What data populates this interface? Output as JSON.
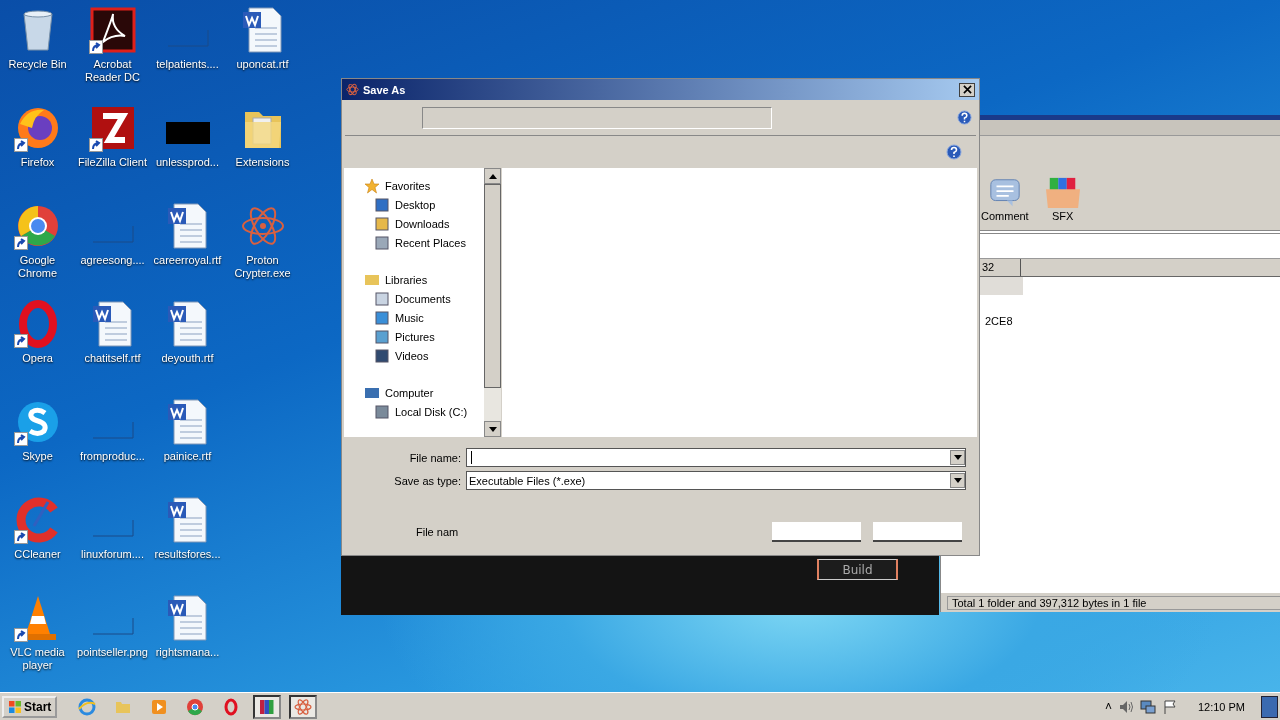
{
  "desktop": {
    "icons": [
      {
        "label": "Recycle Bin",
        "kind": "recycle",
        "shortcut": false
      },
      {
        "label": "Firefox",
        "kind": "firefox",
        "shortcut": true
      },
      {
        "label": "Google Chrome",
        "kind": "chrome",
        "shortcut": true
      },
      {
        "label": "Opera",
        "kind": "opera",
        "shortcut": true
      },
      {
        "label": "Skype",
        "kind": "skype",
        "shortcut": true
      },
      {
        "label": "CCleaner",
        "kind": "ccleaner",
        "shortcut": true
      },
      {
        "label": "VLC media player",
        "kind": "vlc",
        "shortcut": true
      },
      {
        "label": "Acrobat Reader DC",
        "kind": "acrobat",
        "shortcut": true
      },
      {
        "label": "FileZilla Client",
        "kind": "filezilla",
        "shortcut": true
      },
      {
        "label": "agreesong....",
        "kind": "blank",
        "shortcut": false
      },
      {
        "label": "chatitself.rtf",
        "kind": "word",
        "shortcut": false
      },
      {
        "label": "fromproduc...",
        "kind": "blank",
        "shortcut": false
      },
      {
        "label": "linuxforum....",
        "kind": "blank",
        "shortcut": false
      },
      {
        "label": "pointseller.png",
        "kind": "blank",
        "shortcut": false
      },
      {
        "label": "telpatients....",
        "kind": "blank",
        "shortcut": false
      },
      {
        "label": "unlessprod...",
        "kind": "black",
        "shortcut": false
      },
      {
        "label": "careerroyal.rtf",
        "kind": "word",
        "shortcut": false
      },
      {
        "label": "deyouth.rtf",
        "kind": "word",
        "shortcut": false
      },
      {
        "label": "painice.rtf",
        "kind": "word",
        "shortcut": false
      },
      {
        "label": "resultsfores...",
        "kind": "word",
        "shortcut": false
      },
      {
        "label": "rightsmana...",
        "kind": "word",
        "shortcut": false
      },
      {
        "label": "uponcat.rtf",
        "kind": "word",
        "shortcut": false
      },
      {
        "label": "Extensions",
        "kind": "folder",
        "shortcut": false
      },
      {
        "label": "Proton Crypter.exe",
        "kind": "atom",
        "shortcut": false
      }
    ]
  },
  "background_window": {
    "toolbar": [
      {
        "label": "Comment",
        "kind": "comment"
      },
      {
        "label": "SFX",
        "kind": "sfx"
      }
    ],
    "column_header": "32",
    "cell": "2CE8",
    "status_bar": "Total 1 folder and 397,312 bytes in 1 file"
  },
  "dialog": {
    "title": "Save As",
    "nav": [
      {
        "label": "Favorites",
        "kind": "star",
        "children": [
          {
            "label": "Desktop",
            "kind": "desktop"
          },
          {
            "label": "Downloads",
            "kind": "downloads"
          },
          {
            "label": "Recent Places",
            "kind": "recent"
          }
        ]
      },
      {
        "label": "Libraries",
        "kind": "libraries",
        "children": [
          {
            "label": "Documents",
            "kind": "documents"
          },
          {
            "label": "Music",
            "kind": "music"
          },
          {
            "label": "Pictures",
            "kind": "pictures"
          },
          {
            "label": "Videos",
            "kind": "videos"
          }
        ]
      },
      {
        "label": "Computer",
        "kind": "computer",
        "children": [
          {
            "label": "Local Disk (C:)",
            "kind": "disk"
          }
        ]
      }
    ],
    "fields": [
      {
        "label": "File name:"
      },
      {
        "label": "Save as type:",
        "value": "Executable Files (*.exe)"
      }
    ],
    "extra_label": "File nam"
  },
  "panel": {
    "button": "Build"
  },
  "taskbar": {
    "start": "Start",
    "apps": [
      {
        "kind": "ie",
        "selected": false
      },
      {
        "kind": "explorer",
        "selected": false
      },
      {
        "kind": "media",
        "selected": false
      },
      {
        "kind": "chrome",
        "selected": false
      },
      {
        "kind": "opera",
        "selected": false
      },
      {
        "kind": "winrar",
        "selected": true
      },
      {
        "kind": "atom",
        "selected": true
      }
    ],
    "tray_arrow": "˄",
    "clock": "12:10 PM"
  }
}
